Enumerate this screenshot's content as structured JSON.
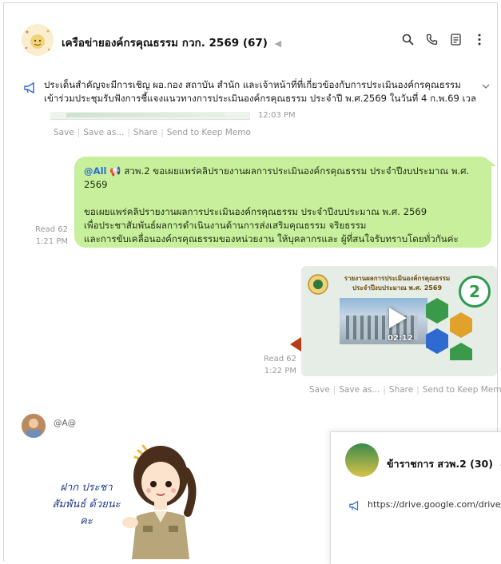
{
  "header": {
    "title": "เครือข่ายองค์กรคุณธรรม กวก. 2569",
    "member_count": "(67)",
    "icons": [
      "search-icon",
      "phone-icon",
      "notes-icon",
      "more-icon"
    ]
  },
  "announcement": {
    "line1": "ประเด็นสำคัญจะมีการเชิญ ผอ.กอง สถาบัน สำนัก และเจ้าหน้าที่ที่เกี่ยวข้องกับการประเมินองค์กรคุณธรรม",
    "line2": "เข้าร่วมประชุมรับฟังการชี้แจงแนวทางการประเมินองค์กรคุณธรรม ประจำปี พ.ศ.2569 ในวันที่ 4 ก.พ.69 เวลา..."
  },
  "messages": {
    "prev_time": "12:03 PM",
    "actions": {
      "save": "Save",
      "save_as": "Save as...",
      "share": "Share",
      "keep": "Send to Keep Memo"
    },
    "text_msg": {
      "mention": "@All",
      "headline": "สวพ.2 ขอเผยแพร่คลิปรายงานผลการประเมินองค์กรคุณธรรม ประจำปีงบประมาณ พ.ศ.",
      "headline2": "2569",
      "body1": "ขอเผยแพร่คลิปรายงานผลการประเมินองค์กรคุณธรรม ประจำปีงบประมาณ พ.ศ. 2569",
      "body2": "เพื่อประชาสัมพันธ์ผลการดำเนินงานด้านการส่งเสริมคุณธรรม จริยธรรม",
      "body3": "และการขับเคลื่อนองค์กรคุณธรรมของหน่วยงาน ให้บุคลากรและ ผู้ที่สนใจรับทราบโดยทั่วกันค่ะ",
      "read": "Read 62",
      "time": "1:21 PM"
    },
    "video_msg": {
      "title_line1": "รายงานผลการประเมินองค์กรคุณธรรม",
      "title_line2": "ประจำปีงบประมาณ พ.ศ. 2569",
      "duration": "02:12",
      "read": "Read 62",
      "time": "1:22 PM"
    },
    "sticker_msg": {
      "sender": "@A@",
      "text": "ฝาก ประชา สัมพันธ์ ด้วยนะคะ"
    }
  },
  "overlay": {
    "title": "ข้าราชการ สวพ.2",
    "count": "(30)",
    "link": "https://drive.google.com/drive/fo"
  }
}
